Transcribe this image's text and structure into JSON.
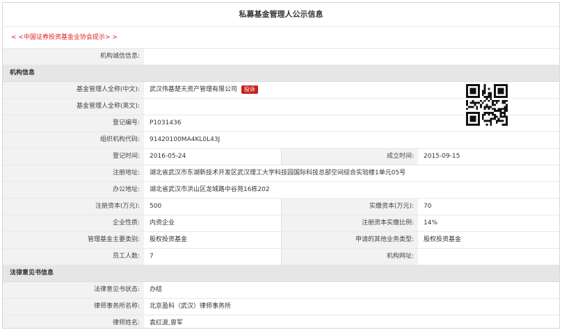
{
  "title": "私募基金管理人公示信息",
  "notice": "< <中国证券投资基金业协会提示> >",
  "integrity_label": "机构诚信信息:",
  "integrity_value": "",
  "sections": {
    "institution": "机构信息",
    "legal": "法律意见书信息"
  },
  "institution": {
    "name_cn_label": "基金管理人全称(中文):",
    "name_cn": "武汉伟基楚天资产管理有限公司",
    "complaint_button": "投诉",
    "name_en_label": "基金管理人全称(英文):",
    "name_en": "",
    "reg_no_label": "登记编号:",
    "reg_no": "P1031436",
    "org_code_label": "组织机构代码:",
    "org_code": "91420100MA4KL0L43J",
    "reg_date_label": "登记时间:",
    "reg_date": "2016-05-24",
    "est_date_label": "成立时间:",
    "est_date": "2015-09-15",
    "reg_addr_label": "注册地址:",
    "reg_addr": "湖北省武汉市东湖新技术开发区武汉理工大学科技园国际科技总部空间综合实验楼1单元05号",
    "office_addr_label": "办公地址:",
    "office_addr": "湖北省武汉市洪山区龙城路中谷苑16栋202",
    "reg_capital_label": "注册资本(万元):",
    "reg_capital": "500",
    "paid_capital_label": "实缴资本(万元):",
    "paid_capital": "70",
    "nature_label": "企业性质:",
    "nature": "内资企业",
    "paid_ratio_label": "注册资本实缴比例:",
    "paid_ratio": "14%",
    "fund_type_label": "管理基金主要类别:",
    "fund_type": "股权投资基金",
    "other_biz_label": "申请的其他业务类型:",
    "other_biz": "股权投资基金",
    "staff_label": "员工人数:",
    "staff": "7",
    "website_label": "机构网址:",
    "website": ""
  },
  "legal": {
    "status_label": "法律意见书状态:",
    "status": "办结",
    "firm_label": "律师事务所名称:",
    "firm": "北京盈科（武汉）律师事务所",
    "lawyer_label": "律师姓名:",
    "lawyer": "袁红波,曾军"
  },
  "icons": {
    "qr": "qr-code-icon"
  }
}
